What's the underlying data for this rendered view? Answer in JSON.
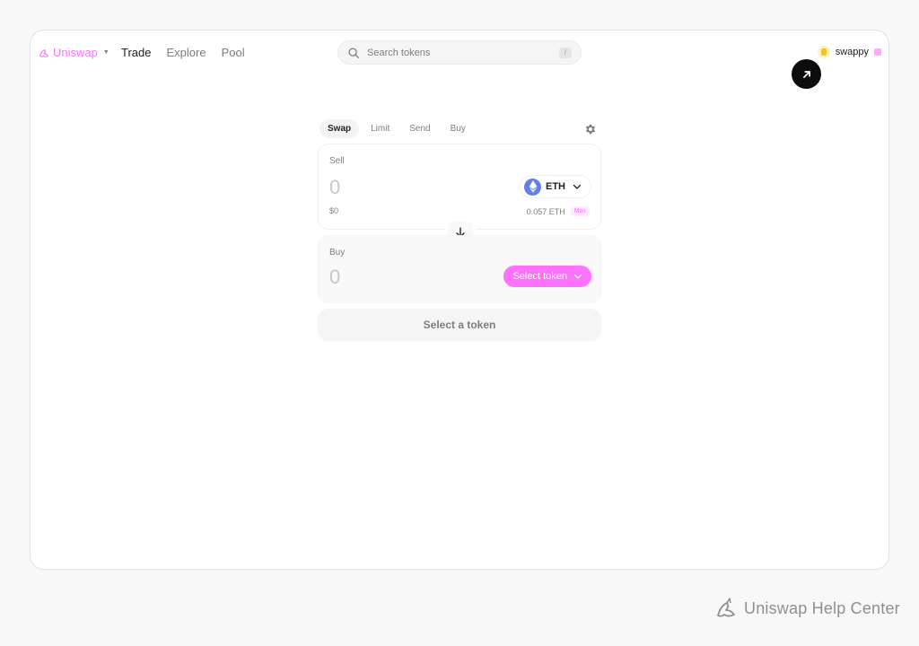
{
  "nav": {
    "brand": "Uniswap",
    "links": [
      "Trade",
      "Explore",
      "Pool"
    ],
    "active_link": "Trade"
  },
  "search": {
    "placeholder": "Search tokens",
    "shortcut": "/"
  },
  "account": {
    "name": "swappy"
  },
  "swap": {
    "tabs": [
      "Swap",
      "Limit",
      "Send",
      "Buy"
    ],
    "active_tab": "Swap",
    "sell": {
      "label": "Sell",
      "amount_placeholder": "0",
      "usd_value": "$0",
      "token": "ETH",
      "balance": "0.057 ETH",
      "max_label": "Max"
    },
    "buy": {
      "label": "Buy",
      "amount_placeholder": "0",
      "token_button": "Select token"
    },
    "submit_label": "Select a token"
  },
  "footer": {
    "brand_text": "Uniswap Help Center"
  },
  "colors": {
    "accent": "#fc72ff",
    "eth": "#627eea",
    "text_primary": "#222222",
    "text_secondary": "#7d7d7d"
  }
}
